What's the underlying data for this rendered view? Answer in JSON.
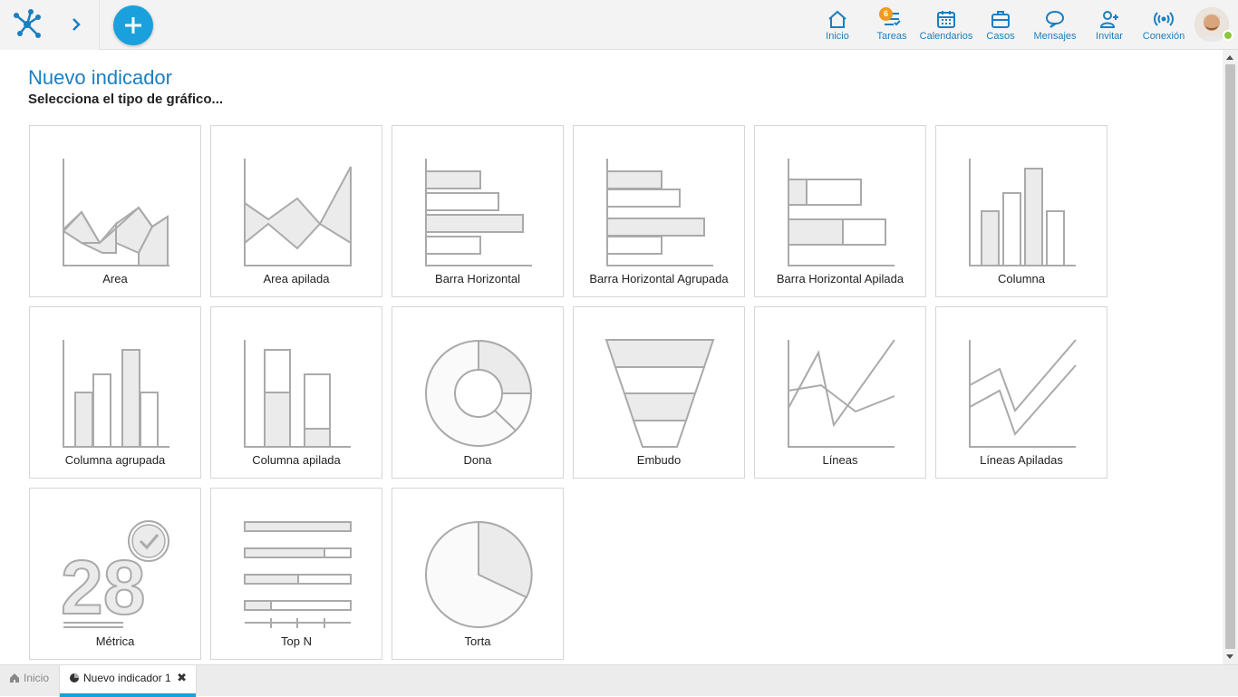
{
  "header": {
    "nav": [
      {
        "label": "Inicio",
        "icon": "home-icon"
      },
      {
        "label": "Tareas",
        "icon": "tasks-icon",
        "badge": "6"
      },
      {
        "label": "Calendarios",
        "icon": "calendar-icon"
      },
      {
        "label": "Casos",
        "icon": "briefcase-icon"
      },
      {
        "label": "Mensajes",
        "icon": "chat-icon"
      },
      {
        "label": "Invitar",
        "icon": "invite-user-icon"
      },
      {
        "label": "Conexión",
        "icon": "connection-icon"
      }
    ]
  },
  "page": {
    "title": "Nuevo indicador",
    "subtitle": "Selecciona el tipo de gráfico..."
  },
  "chart_types": [
    "Area",
    "Area apilada",
    "Barra Horizontal",
    "Barra Horizontal Agrupada",
    "Barra Horizontal Apilada",
    "Columna",
    "Columna agrupada",
    "Columna apilada",
    "Dona",
    "Embudo",
    "Líneas",
    "Líneas Apiladas",
    "Métrica",
    "Top N",
    "Torta"
  ],
  "metric_sample": "28",
  "footer": {
    "home_tab": "Inicio",
    "active_tab": "Nuevo indicador 1",
    "close_symbol": "✖"
  },
  "colors": {
    "accent": "#1aa0dc",
    "nav_text": "#1a7fc1",
    "badge": "#f29a1d",
    "icon_fill": "#ebebeb",
    "icon_stroke": "#aaaaaa"
  }
}
